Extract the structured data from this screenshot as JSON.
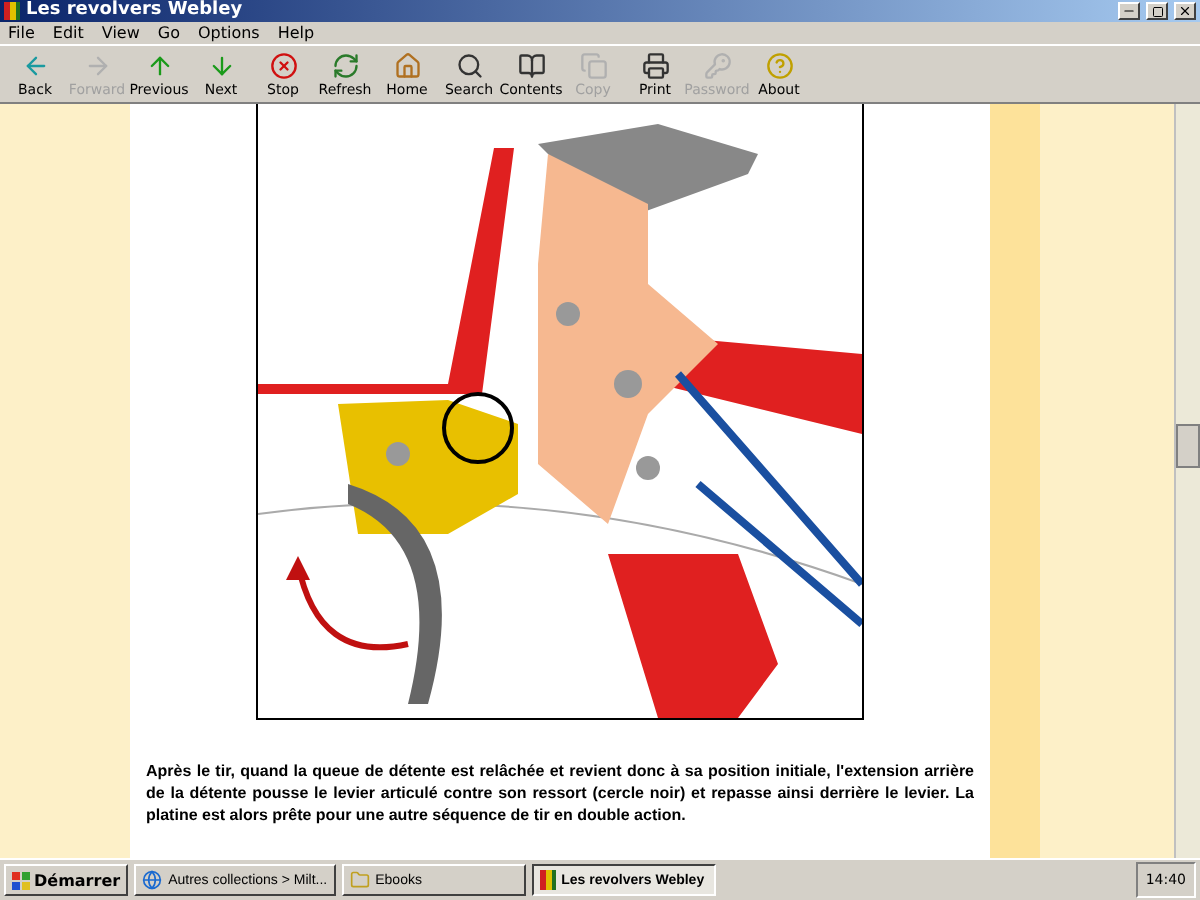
{
  "window": {
    "title": "Les revolvers Webley"
  },
  "menu": [
    "File",
    "Edit",
    "View",
    "Go",
    "Options",
    "Help"
  ],
  "toolbar": [
    {
      "label": "Back",
      "disabled": false
    },
    {
      "label": "Forward",
      "disabled": true
    },
    {
      "label": "Previous",
      "disabled": false
    },
    {
      "label": "Next",
      "disabled": false
    },
    {
      "label": "Stop",
      "disabled": false
    },
    {
      "label": "Refresh",
      "disabled": false
    },
    {
      "label": "Home",
      "disabled": false
    },
    {
      "label": "Search",
      "disabled": false
    },
    {
      "label": "Contents",
      "disabled": false
    },
    {
      "label": "Copy",
      "disabled": true
    },
    {
      "label": "Print",
      "disabled": false
    },
    {
      "label": "Password",
      "disabled": true
    },
    {
      "label": "About",
      "disabled": false
    }
  ],
  "content": {
    "paragraph": "Après le tir, quand la queue de détente est relâchée et revient donc à sa position initiale, l'extension arrière de la détente pousse le levier articulé contre son ressort (cercle noir) et repasse ainsi derrière le levier. La platine est alors prête pour une autre séquence de tir en double action."
  },
  "taskbar": {
    "start": "Démarrer",
    "tasks": [
      {
        "label": "Autres collections > Milt...",
        "selected": false
      },
      {
        "label": "Ebooks",
        "selected": false
      },
      {
        "label": "Les revolvers Webley",
        "selected": true
      }
    ],
    "clock": "14:40"
  }
}
